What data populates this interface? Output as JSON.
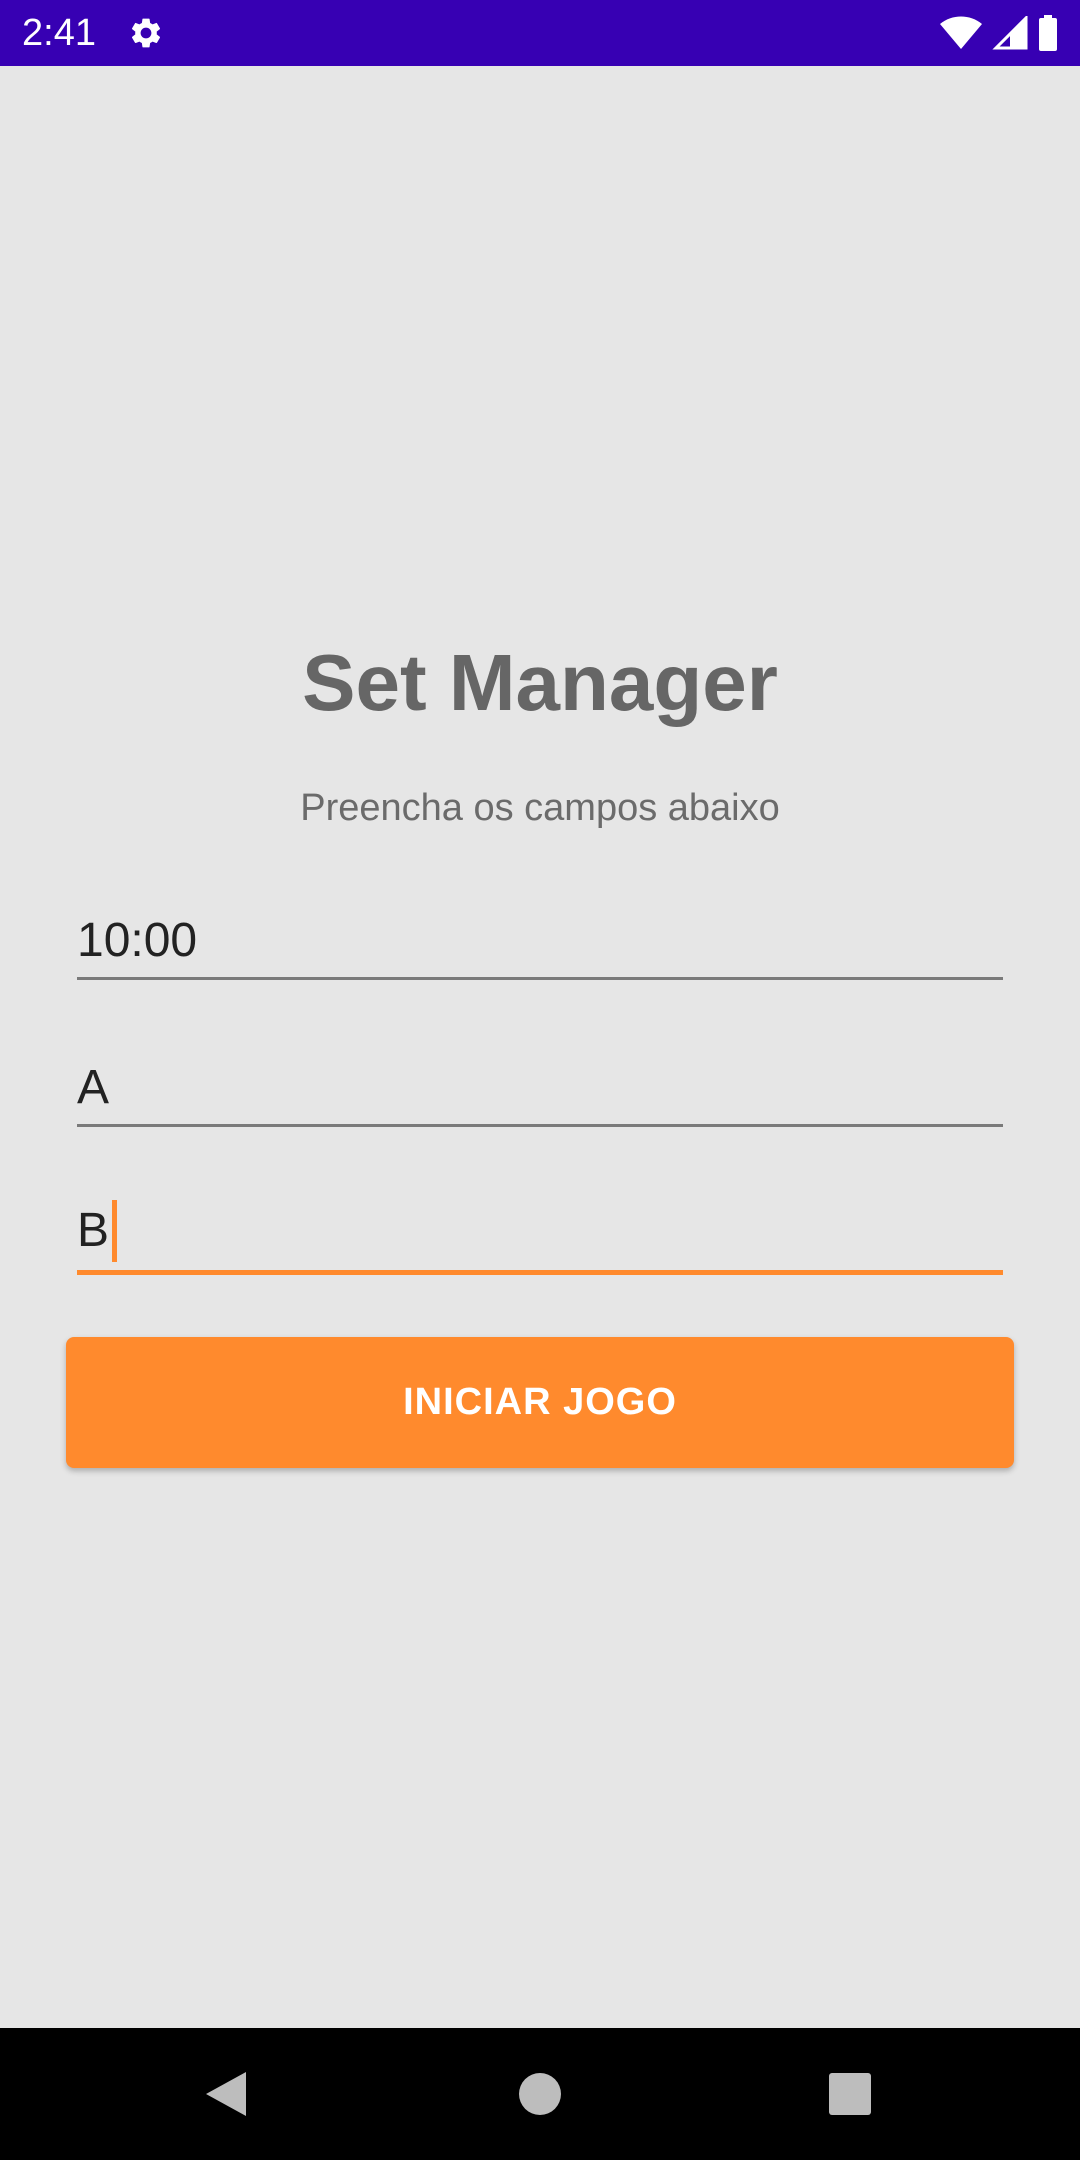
{
  "status_bar": {
    "time": "2:41",
    "background": "#3700b3",
    "icons": [
      "gear-icon",
      "wifi-icon",
      "signal-icon",
      "battery-icon"
    ]
  },
  "main": {
    "title": "Set Manager",
    "subtitle": "Preencha os campos abaixo",
    "fields": [
      {
        "value": "10:00",
        "focused": false
      },
      {
        "value": "A",
        "focused": false
      },
      {
        "value": "B",
        "focused": true
      }
    ],
    "start_button_label": "INICIAR JOGO",
    "accent_color": "#ff8a2d",
    "background": "#e6e6e6"
  },
  "nav_bar": {
    "icons": [
      "back-icon",
      "home-icon",
      "recents-icon"
    ]
  }
}
